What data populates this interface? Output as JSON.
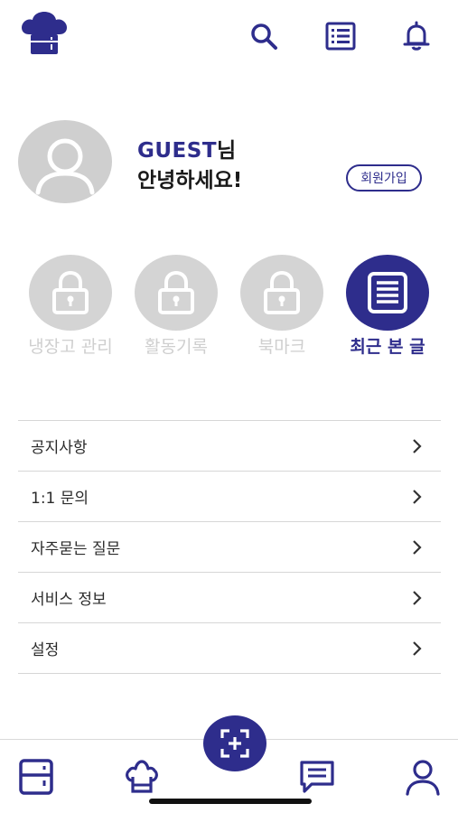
{
  "colors": {
    "primary": "#2e2d8c",
    "inactive": "#d4d4d4",
    "text": "#2b2b2b"
  },
  "topbar": {
    "logo_icon": "chef-hat-fridge-logo",
    "icons": [
      "search-icon",
      "list-icon",
      "bell-icon"
    ]
  },
  "profile": {
    "name": "GUEST",
    "name_suffix": "님",
    "greeting": "안녕하세요!",
    "signup_label": "회원가입"
  },
  "quick_actions": [
    {
      "label": "냉장고 관리",
      "icon": "lock-icon",
      "locked": true
    },
    {
      "label": "활동기록",
      "icon": "lock-icon",
      "locked": true
    },
    {
      "label": "북마크",
      "icon": "lock-icon",
      "locked": true
    },
    {
      "label": "최근 본 글",
      "icon": "document-icon",
      "locked": false
    }
  ],
  "menu": [
    {
      "label": "공지사항"
    },
    {
      "label": "1:1 문의"
    },
    {
      "label": "자주묻는 질문"
    },
    {
      "label": "서비스 정보"
    },
    {
      "label": "설정"
    }
  ],
  "bottom_nav": [
    "fridge-icon",
    "chef-hat-icon",
    "scan-add-icon",
    "chat-icon",
    "profile-icon"
  ]
}
